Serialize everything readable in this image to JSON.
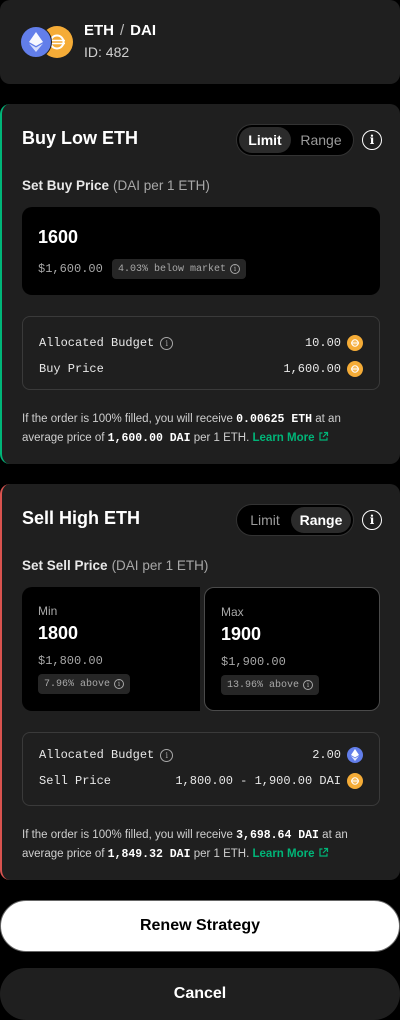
{
  "pair": {
    "base": "ETH",
    "quote": "DAI",
    "separator": "/",
    "id_label": "ID: 482"
  },
  "buy": {
    "title": "Buy Low ETH",
    "toggle": {
      "limit": "Limit",
      "range": "Range",
      "active": "Limit"
    },
    "price_label": "Set Buy Price",
    "price_unit": "(DAI per 1 ETH)",
    "input": {
      "value": "1600",
      "fiat": "$1,600.00",
      "market_badge": "4.03% below market"
    },
    "budget": {
      "label": "Allocated Budget",
      "value": "10.00",
      "token_icon": "dai-coin-icon"
    },
    "price_row": {
      "label": "Buy Price",
      "value": "1,600.00",
      "token_icon": "dai-coin-icon"
    },
    "note": {
      "prefix": "If the order is 100% filled, you will receive",
      "amount": "0.00625 ETH",
      "mid": "at an average price of",
      "price": "1,600.00 DAI",
      "suffix": "per 1 ETH.",
      "link": "Learn More"
    }
  },
  "sell": {
    "title": "Sell High ETH",
    "toggle": {
      "limit": "Limit",
      "range": "Range",
      "active": "Range"
    },
    "price_label": "Set Sell Price",
    "price_unit": "(DAI per 1 ETH)",
    "min": {
      "label": "Min",
      "value": "1800",
      "fiat": "$1,800.00",
      "badge": "7.96% above"
    },
    "max": {
      "label": "Max",
      "value": "1900",
      "fiat": "$1,900.00",
      "badge": "13.96% above"
    },
    "budget": {
      "label": "Allocated Budget",
      "value": "2.00",
      "token_icon": "eth-coin-icon"
    },
    "price_row": {
      "label": "Sell Price",
      "value": "1,800.00 - 1,900.00 DAI",
      "token_icon": "dai-coin-icon"
    },
    "note": {
      "prefix": "If the order is 100% filled, you will receive",
      "amount": "3,698.64 DAI",
      "mid": "at an average price of",
      "price": "1,849.32 DAI",
      "suffix": "per 1 ETH.",
      "link": "Learn More"
    }
  },
  "actions": {
    "renew": "Renew Strategy",
    "cancel": "Cancel"
  },
  "colors": {
    "buy_accent": "#00b578",
    "sell_accent": "#d9534f",
    "eth": "#627eea",
    "dai": "#f5ac37"
  }
}
